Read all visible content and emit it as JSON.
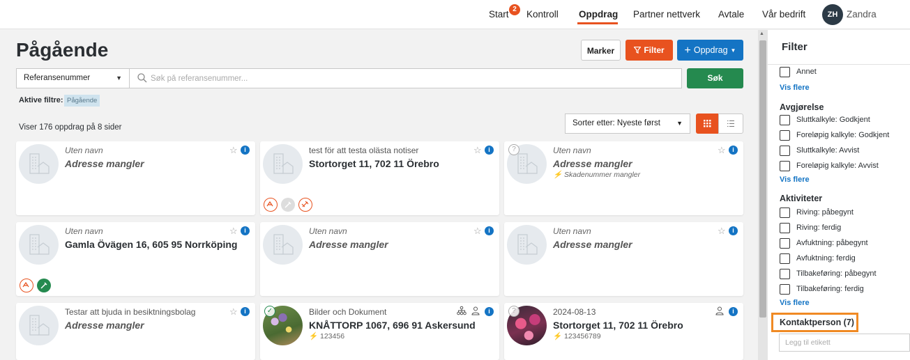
{
  "nav": {
    "items": [
      "Start",
      "Kontroll",
      "Oppdrag",
      "Partner nettverk",
      "Avtale",
      "Vår bedrift"
    ],
    "badge": "2",
    "avatar_initials": "ZH",
    "user_name": "Zandra",
    "active": "Oppdrag"
  },
  "page": {
    "title": "Pågående",
    "marker_label": "Marker",
    "filter_label": "Filter",
    "oppdrag_label": "Oppdrag"
  },
  "search": {
    "field_select": "Referansenummer",
    "placeholder": "Søk på referansenummer...",
    "button": "Søk"
  },
  "active_filters": {
    "label": "Aktive filtre:",
    "chips": [
      "Pågående"
    ]
  },
  "results": {
    "count_text": "Viser 176 oppdrag på 8 sider",
    "sort_label": "Sorter etter: Nyeste først"
  },
  "cards": [
    {
      "sub": "Uten navn",
      "title": "Adresse mangler",
      "extra": ""
    },
    {
      "sub": "test för att testa olästa notiser",
      "title": "Stortorget 11, 702 11 Örebro",
      "extra": ""
    },
    {
      "sub": "Uten navn",
      "title": "Adresse mangler",
      "extra": "Skadenummer mangler"
    },
    {
      "sub": "Uten navn",
      "title": "Gamla Övägen 16, 605 95 Norrköping",
      "extra": ""
    },
    {
      "sub": "Uten navn",
      "title": "Adresse mangler",
      "extra": ""
    },
    {
      "sub": "Uten navn",
      "title": "Adresse mangler",
      "extra": ""
    },
    {
      "sub": "Testar att bjuda in besiktningsbolag",
      "title": "Adresse mangler",
      "extra": ""
    },
    {
      "sub": "Bilder och Dokument",
      "title": "KNÅTTORP 1067, 696 91 Askersund",
      "extra": "123456"
    },
    {
      "sub": "2024-08-13",
      "title": "Stortorget 11, 702 11 Örebro",
      "extra": "123456789"
    }
  ],
  "sidebar": {
    "title": "Filter",
    "annet": "Annet",
    "vis_flere": "Vis flere",
    "avgjorelse_title": "Avgjørelse",
    "avgjorelse": [
      "Sluttkalkyle: Godkjent",
      "Foreløpig kalkyle: Godkjent",
      "Sluttkalkyle: Avvist",
      "Foreløpig kalkyle: Avvist"
    ],
    "aktiviteter_title": "Aktiviteter",
    "aktiviteter": [
      "Riving: påbegynt",
      "Riving: ferdig",
      "Avfuktning: påbegynt",
      "Avfuktning: ferdig",
      "Tilbakeføring: påbegynt",
      "Tilbakeføring: ferdig"
    ],
    "kontakt_title": "Kontaktperson (7)",
    "tag_placeholder": "Legg til etikett"
  },
  "colors": {
    "accent_orange": "#e8521f",
    "primary_blue": "#1474c4",
    "success_green": "#258a4f",
    "highlight_orange": "#f08a24"
  }
}
